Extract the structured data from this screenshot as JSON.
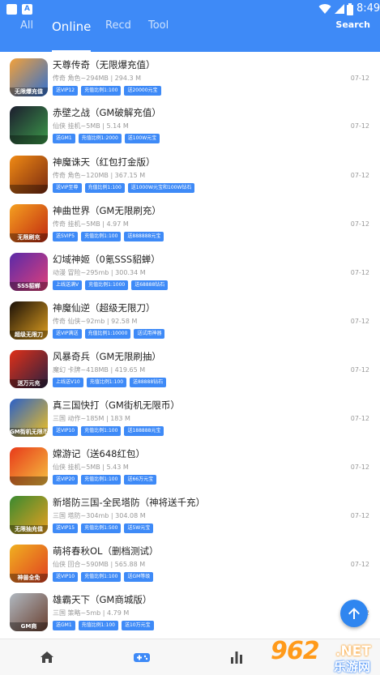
{
  "status_bar": {
    "time": "8:49",
    "icons": [
      "app-icon",
      "a-icon",
      "wifi-icon",
      "signal-icon",
      "battery-icon"
    ]
  },
  "tabs": [
    {
      "label": "All",
      "active": false
    },
    {
      "label": "Online",
      "active": true
    },
    {
      "label": "Recd",
      "active": false
    },
    {
      "label": "Tool",
      "active": false
    }
  ],
  "search_label": "Search",
  "games": [
    {
      "title": "天尊传奇（无限爆充值）",
      "meta": "传奇 角色~294MB | 294.3 M",
      "tags": [
        "送VIP12",
        "充值比例1:100",
        "送20000元宝"
      ],
      "date": "07-12",
      "icon_caption": "无限爆充值",
      "colors": [
        "#f3a13a",
        "#2e6fd1"
      ]
    },
    {
      "title": "赤壁之战（GM破解充值）",
      "meta": "仙侠 挂机~5MB | 5.14 M",
      "tags": [
        "送GM1",
        "充值比例1:2000",
        "送100W元宝"
      ],
      "date": "07-12",
      "icon_caption": "",
      "colors": [
        "#1c1c2e",
        "#3c9a4a"
      ]
    },
    {
      "title": "神魔诛天（红包打金版）",
      "meta": "传奇 角色~120MB | 367.15 M",
      "tags": [
        "送VIP至尊",
        "充值比例1:100",
        "送1000W元宝和100W钻石"
      ],
      "date": "07-12",
      "icon_caption": "",
      "colors": [
        "#f08a14",
        "#7a2a10"
      ]
    },
    {
      "title": "神曲世界（GM无限刷充）",
      "meta": "传奇 挂机~5MB | 4.97 M",
      "tags": [
        "送SVIP5",
        "充值比例1:100",
        "送888888元宝"
      ],
      "date": "07-12",
      "icon_caption": "无限刷充",
      "colors": [
        "#f5a020",
        "#c0280f"
      ]
    },
    {
      "title": "幻域神姬（0氪SSS貂蝉）",
      "meta": "动漫 冒险~295mb | 300.34 M",
      "tags": [
        "上线送满V",
        "充值比例1:1000",
        "送68888钻石"
      ],
      "date": "07-12",
      "icon_caption": "SSS貂蝉",
      "colors": [
        "#5a2aa8",
        "#e0407a"
      ]
    },
    {
      "title": "神魔仙逆（超级无限刀）",
      "meta": "传奇 仙侠~92mb | 92.58 M",
      "tags": [
        "送VIP满送",
        "充值比例1:10000",
        "送试用神器"
      ],
      "date": "07-12",
      "icon_caption": "超级无限刀",
      "colors": [
        "#1a1008",
        "#e0a020"
      ]
    },
    {
      "title": "风暴奇兵（GM无限刷抽）",
      "meta": "魔幻 卡牌~418MB | 419.65 M",
      "tags": [
        "上线送V10",
        "充值比例1:100",
        "送88888钻石"
      ],
      "date": "07-12",
      "icon_caption": "送万元充",
      "colors": [
        "#e03018",
        "#2a2040"
      ]
    },
    {
      "title": "真三国快打（GM街机无限币）",
      "meta": "三国 动作~185M | 183 M",
      "tags": [
        "送VIP10",
        "充值比例1:100",
        "送188888元宝"
      ],
      "date": "07-12",
      "icon_caption": "GM街机无限币",
      "colors": [
        "#2a60c8",
        "#f0c020"
      ]
    },
    {
      "title": "嫦游记（送648红包）",
      "meta": "仙侠 挂机~5MB | 5.43 M",
      "tags": [
        "送VIP20",
        "充值比例1:100",
        "送66万元宝"
      ],
      "date": "07-12",
      "icon_caption": "",
      "colors": [
        "#e83a1a",
        "#f5c040"
      ]
    },
    {
      "title": "新塔防三国-全民塔防（神将送千充）",
      "meta": "三国 塔防~304mb | 304.08 M",
      "tags": [
        "送VIP15",
        "充值比例1:500",
        "送5W元宝"
      ],
      "date": "07-12",
      "icon_caption": "无限抽充值",
      "colors": [
        "#3a8a30",
        "#e8a020"
      ]
    },
    {
      "title": "萌将春秋OL（删档测试）",
      "meta": "仙侠 回合~590MB | 565.88 M",
      "tags": [
        "送VIP10",
        "充值比例1:100",
        "送GM等级"
      ],
      "date": "07-12",
      "icon_caption": "神兽全免",
      "colors": [
        "#f0b020",
        "#e04020"
      ]
    },
    {
      "title": "雄霸天下（GM商城版）",
      "meta": "三国 策略~5mb | 4.79 M",
      "tags": [
        "送GM1",
        "充值比例1:100",
        "送10万元宝"
      ],
      "date": "07-12",
      "icon_caption": "GM商",
      "colors": [
        "#b0b8c0",
        "#6a4030"
      ]
    }
  ],
  "bottom_nav": [
    "home-icon",
    "gamepad-icon",
    "bar-chart-icon"
  ],
  "fab_icon": "arrow-up-icon",
  "watermark": {
    "number": "962",
    "suffix": ".NET",
    "cn": "乐游网"
  },
  "accent_color": "#3e8af7"
}
